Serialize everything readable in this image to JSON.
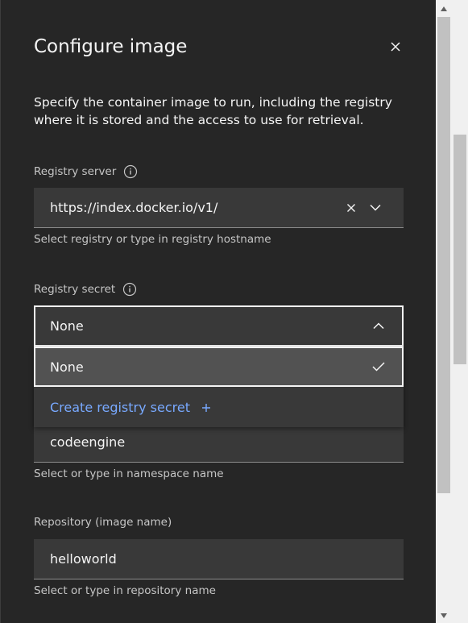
{
  "panel": {
    "title": "Configure image",
    "description": "Specify the container image to run, including the registry where it is stored and the access to use for retrieval."
  },
  "registry_server": {
    "label": "Registry server",
    "value": "https://index.docker.io/v1/",
    "helper": "Select registry or type in registry hostname"
  },
  "registry_secret": {
    "label": "Registry secret",
    "value": "None",
    "options": [
      {
        "label": "None",
        "selected": true
      },
      {
        "label": "Create registry secret"
      }
    ]
  },
  "namespace": {
    "value": "codeengine",
    "helper": "Select or type in namespace name"
  },
  "repository": {
    "label": "Repository (image name)",
    "value": "helloworld",
    "helper": "Select or type in repository name"
  },
  "colors": {
    "background": "#262626",
    "field": "#393939",
    "link": "#78a9ff",
    "text": "#f4f4f4",
    "label": "#c6c6c6"
  }
}
